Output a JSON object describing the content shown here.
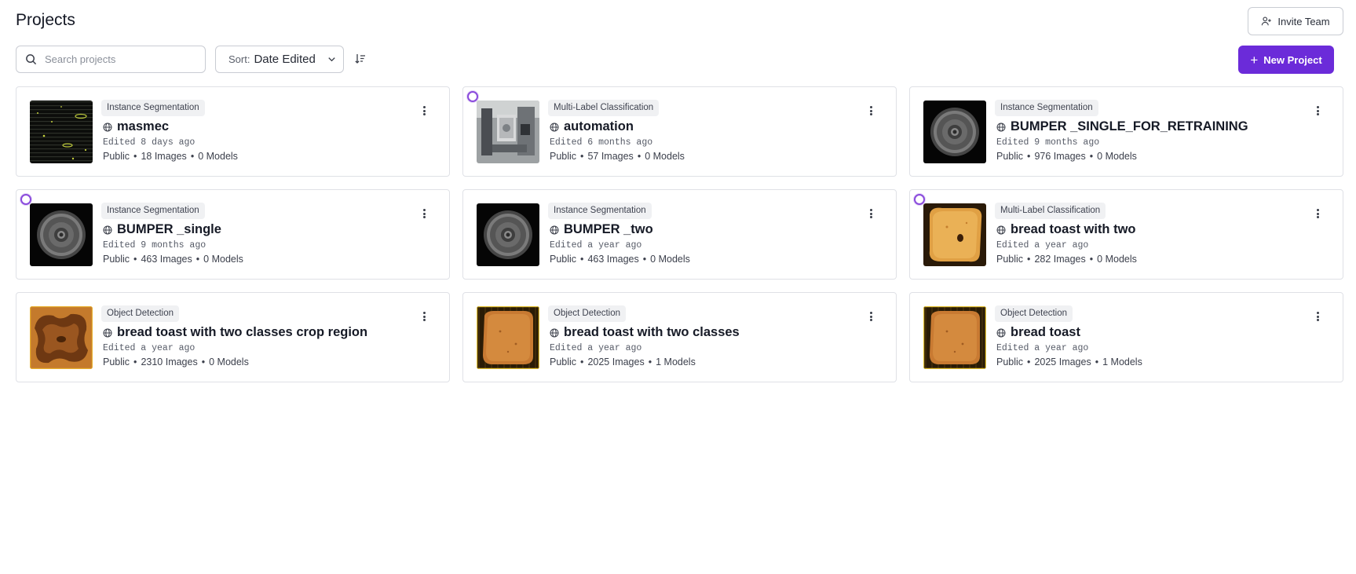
{
  "header": {
    "title": "Projects",
    "invite_label": "Invite Team"
  },
  "toolbar": {
    "search_placeholder": "Search projects",
    "sort_label": "Sort:",
    "sort_value": "Date Edited",
    "new_project_label": "New Project"
  },
  "projects": [
    {
      "type": "Instance Segmentation",
      "name": "masmec",
      "edited": "Edited 8 days ago",
      "visibility": "Public",
      "images": "18 Images",
      "models": "0 Models",
      "thumbnail": "dark-lines",
      "selection_ring": false
    },
    {
      "type": "Multi-Label Classification",
      "name": "automation",
      "edited": "Edited 6 months ago",
      "visibility": "Public",
      "images": "57 Images",
      "models": "0 Models",
      "thumbnail": "machine",
      "selection_ring": true
    },
    {
      "type": "Instance Segmentation",
      "name": "BUMPER _SINGLE_FOR_RETRAINING",
      "edited": "Edited 9 months ago",
      "visibility": "Public",
      "images": "976 Images",
      "models": "0 Models",
      "thumbnail": "bumper",
      "selection_ring": false
    },
    {
      "type": "Instance Segmentation",
      "name": "BUMPER _single",
      "edited": "Edited 9 months ago",
      "visibility": "Public",
      "images": "463 Images",
      "models": "0 Models",
      "thumbnail": "bumper",
      "selection_ring": true
    },
    {
      "type": "Instance Segmentation",
      "name": "BUMPER _two",
      "edited": "Edited a year ago",
      "visibility": "Public",
      "images": "463 Images",
      "models": "0 Models",
      "thumbnail": "bumper",
      "selection_ring": false
    },
    {
      "type": "Multi-Label Classification",
      "name": "bread toast with two",
      "edited": "Edited a year ago",
      "visibility": "Public",
      "images": "282 Images",
      "models": "0 Models",
      "thumbnail": "toast-light",
      "selection_ring": true
    },
    {
      "type": "Object Detection",
      "name": "bread toast with two classes crop region",
      "edited": "Edited a year ago",
      "visibility": "Public",
      "images": "2310 Images",
      "models": "0 Models",
      "thumbnail": "toast-dark",
      "selection_ring": false
    },
    {
      "type": "Object Detection",
      "name": "bread toast with two classes",
      "edited": "Edited a year ago",
      "visibility": "Public",
      "images": "2025 Images",
      "models": "1 Models",
      "thumbnail": "toast",
      "selection_ring": false
    },
    {
      "type": "Object Detection",
      "name": "bread toast",
      "edited": "Edited a year ago",
      "visibility": "Public",
      "images": "2025 Images",
      "models": "1 Models",
      "thumbnail": "toast",
      "selection_ring": false
    }
  ],
  "colors": {
    "accent": "#6b2bd9",
    "selection_ring": "#8a4bdc"
  }
}
